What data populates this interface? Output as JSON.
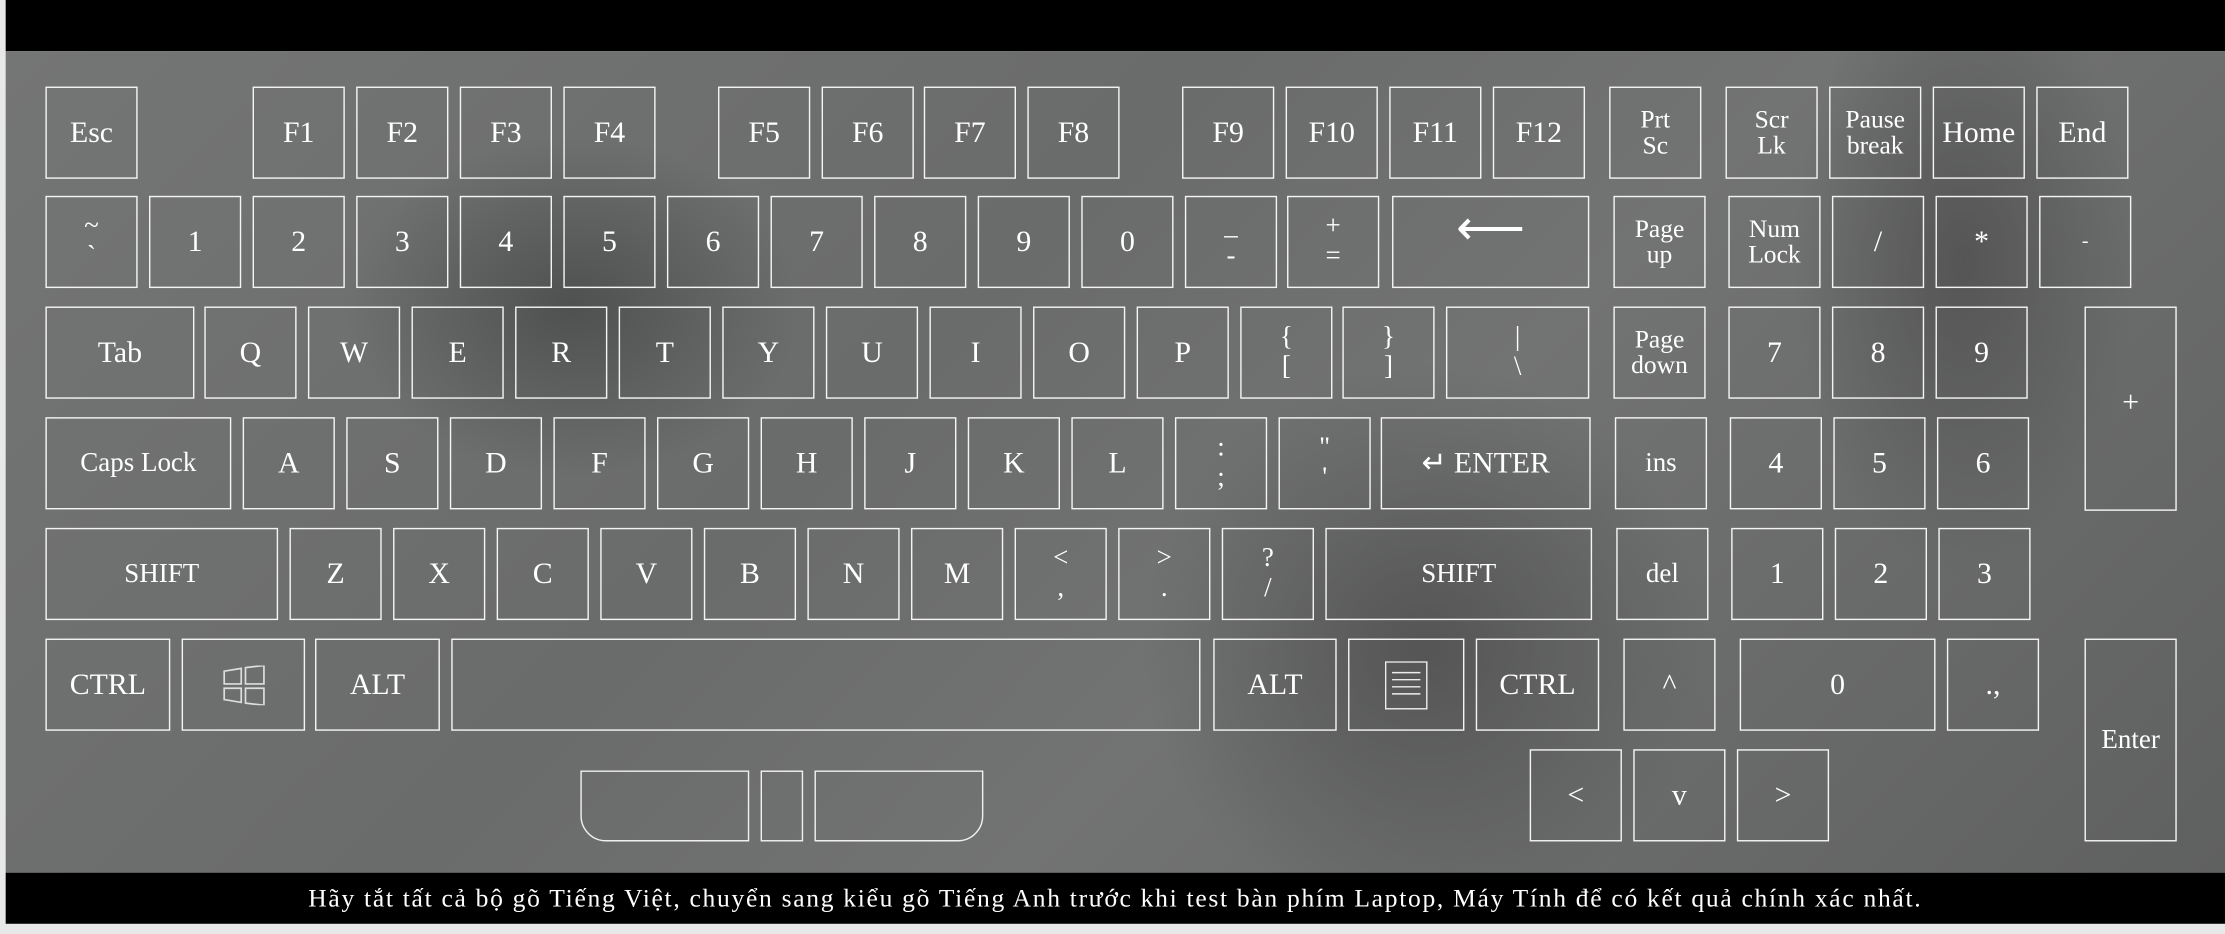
{
  "notice": "Hãy tắt tất cả bộ gõ Tiếng Việt, chuyển sang kiểu gõ Tiếng Anh trước khi test bàn phím Laptop, Máy Tính để có kết quả chính xác nhất.",
  "keys": {
    "esc": "Esc",
    "f1": "F1",
    "f2": "F2",
    "f3": "F3",
    "f4": "F4",
    "f5": "F5",
    "f6": "F6",
    "f7": "F7",
    "f8": "F8",
    "f9": "F9",
    "f10": "F10",
    "f11": "F11",
    "f12": "F12",
    "prtsc": [
      "Prt",
      "Sc"
    ],
    "scrlk": [
      "Scr",
      "Lk"
    ],
    "pause": [
      "Pause",
      "break"
    ],
    "home": "Home",
    "end": "End",
    "tilde": [
      "~",
      "`"
    ],
    "d1": "1",
    "d2": "2",
    "d3": "3",
    "d4": "4",
    "d5": "5",
    "d6": "6",
    "d7": "7",
    "d8": "8",
    "d9": "9",
    "d0": "0",
    "minus": [
      "_",
      "-"
    ],
    "equal": [
      "+",
      "="
    ],
    "backspace": "⟵",
    "pageup": [
      "Page",
      "up"
    ],
    "numlock": [
      "Num",
      "Lock"
    ],
    "numdiv": "/",
    "nummul": "*",
    "numsub": "-",
    "tab": "Tab",
    "q": "Q",
    "w": "W",
    "e": "E",
    "r": "R",
    "t": "T",
    "y": "Y",
    "u": "U",
    "i": "I",
    "o": "O",
    "p": "P",
    "lbrace": [
      "{",
      "["
    ],
    "rbrace": [
      "}",
      "]"
    ],
    "pipe": [
      "|",
      "\\"
    ],
    "pagedown": [
      "Page",
      "down"
    ],
    "num7": "7",
    "num8": "8",
    "num9": "9",
    "numadd": "+",
    "caps": "Caps Lock",
    "a": "A",
    "s": "S",
    "d": "D",
    "f": "F",
    "g": "G",
    "h": "H",
    "j": "J",
    "k": "K",
    "l": "L",
    "semicolon": [
      ":",
      ";"
    ],
    "quote": [
      "\"",
      "'"
    ],
    "enter": "↵ ENTER",
    "ins": "ins",
    "num4": "4",
    "num5": "5",
    "num6": "6",
    "lshift": "SHIFT",
    "z": "Z",
    "x": "X",
    "c": "C",
    "v": "V",
    "b": "B",
    "n": "N",
    "m": "M",
    "comma": [
      "<",
      ","
    ],
    "period": [
      ">",
      "."
    ],
    "slash": [
      "?",
      "/"
    ],
    "rshift": "SHIFT",
    "del": "del",
    "num1": "1",
    "num2": "2",
    "num3": "3",
    "lctrl": "CTRL",
    "win": "",
    "lalt": "ALT",
    "space": "",
    "ralt": "ALT",
    "menu": "",
    "rctrl": "CTRL",
    "up": "^",
    "num0": "0",
    "numdot": ".,",
    "numenter": "Enter",
    "left": "<",
    "down": "v",
    "right": ">"
  },
  "icons": {
    "win": "windows-logo-icon",
    "menu": "context-menu-icon"
  }
}
